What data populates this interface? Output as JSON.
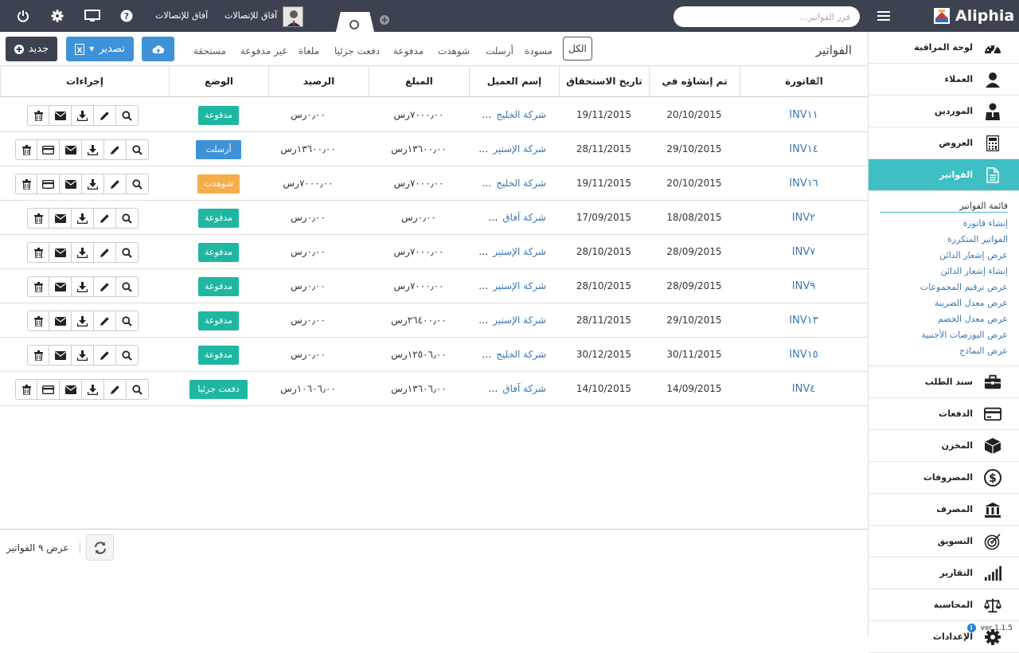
{
  "topbar": {
    "search_placeholder": "فرز الفواتير...",
    "company_name": "آفاق للإتصالات",
    "company_name2": "آفاق للإتصالات",
    "brand": "Aliphia"
  },
  "sidebar": {
    "items": [
      {
        "label": "لوحة المراقبة",
        "icon": "dashboard-icon"
      },
      {
        "label": "العملاء",
        "icon": "user-icon"
      },
      {
        "label": "الموردين",
        "icon": "supplier-icon"
      },
      {
        "label": "العروض",
        "icon": "calculator-icon"
      },
      {
        "label": "الفواتير",
        "icon": "document-icon"
      },
      {
        "label": "سند الطلب",
        "icon": "briefcase-icon"
      },
      {
        "label": "الدفعات",
        "icon": "credit-card-icon"
      },
      {
        "label": "المخزن",
        "icon": "cube-icon"
      },
      {
        "label": "المصروفات",
        "icon": "dollar-icon"
      },
      {
        "label": "المصرف",
        "icon": "bank-icon"
      },
      {
        "label": "التسويق",
        "icon": "target-icon"
      },
      {
        "label": "التقارير",
        "icon": "bar-chart-icon"
      },
      {
        "label": "المحاسبة",
        "icon": "balance-scale-icon"
      },
      {
        "label": "الإعدادات",
        "icon": "gear-icon"
      }
    ],
    "submenu": {
      "heading": "قائمة الفواتير",
      "links": [
        "إنشاء فاتورة",
        "الفواتير المتكررة",
        "عرض إشعار الدائن",
        "إنشاء إشعار الدائن",
        "عرض ترقيم المجموعات",
        "عرض معدل الضريبة",
        "عرض معدل الخصم",
        "عرض البورصات الأجنبية",
        "عرض النماذج"
      ]
    },
    "version": "ver 1.1.5"
  },
  "toolbar": {
    "new_label": "جديد",
    "export_label": "تصدير",
    "page_title": "الفواتير",
    "filters": [
      "الكل",
      "مسودة",
      "أرسلت",
      "شوهدت",
      "مدفوعة",
      "دفعت جزئيا",
      "ملغاة",
      "غير مدفوعة",
      "مستحقة"
    ]
  },
  "table": {
    "headers": {
      "invoice": "الفاتورة",
      "created": "تم إنشاؤه في",
      "due": "تاريخ الاستحقاق",
      "client": "إسم العميل",
      "amount": "المبلغ",
      "balance": "الرصيد",
      "status": "الوضع",
      "actions": "إجراءات"
    },
    "rows": [
      {
        "invoice": "INV١١",
        "created": "20/10/2015",
        "due": "19/11/2015",
        "client": "شركة الخليج",
        "amount": "٧٠٠٠٫٠٠رس",
        "balance": "٠٫٠٠رس",
        "status": "مدفوعة",
        "status_type": "paid",
        "extended": false
      },
      {
        "invoice": "INV١٤",
        "created": "29/10/2015",
        "due": "28/11/2015",
        "client": "شركة الإستير",
        "amount": "١٣٦٠٠٫٠٠رس",
        "balance": "١٣٦٠٠٫٠٠رس",
        "status": "أرسلت",
        "status_type": "sent",
        "extended": true
      },
      {
        "invoice": "INV١٦",
        "created": "20/10/2015",
        "due": "19/11/2015",
        "client": "شركة الخليج",
        "amount": "٧٠٠٠٫٠٠رس",
        "balance": "٧٠٠٠٫٠٠رس",
        "status": "شوهدت",
        "status_type": "seen",
        "extended": true
      },
      {
        "invoice": "INV٢",
        "created": "18/08/2015",
        "due": "17/09/2015",
        "client": "شركة آفاق",
        "amount": "٠٫٠٠رس",
        "balance": "٠٫٠٠رس",
        "status": "مدفوعة",
        "status_type": "paid",
        "extended": false
      },
      {
        "invoice": "INV٧",
        "created": "28/09/2015",
        "due": "28/10/2015",
        "client": "شركة الإستير",
        "amount": "٧٠٠٠٫٠٠رس",
        "balance": "٠٫٠٠رس",
        "status": "مدفوعة",
        "status_type": "paid",
        "extended": false
      },
      {
        "invoice": "INV٩",
        "created": "28/09/2015",
        "due": "28/10/2015",
        "client": "شركة الإستير",
        "amount": "٧٠٠٠٫٠٠رس",
        "balance": "٠٫٠٠رس",
        "status": "مدفوعة",
        "status_type": "paid",
        "extended": false
      },
      {
        "invoice": "INV١٣",
        "created": "29/10/2015",
        "due": "28/11/2015",
        "client": "شركة الإستير",
        "amount": "٢٦٤٠٠٫٠٠رس",
        "balance": "٠٫٠٠رس",
        "status": "مدفوعة",
        "status_type": "paid",
        "extended": false
      },
      {
        "invoice": "INV١٥",
        "created": "30/11/2015",
        "due": "30/12/2015",
        "client": "شركة الخليج",
        "amount": "١٢٥٠٦٫٠٠رس",
        "balance": "٠٫٠٠رس",
        "status": "مدفوعة",
        "status_type": "paid",
        "extended": false
      },
      {
        "invoice": "INV٤",
        "created": "14/09/2015",
        "due": "14/10/2015",
        "client": "شركة آفاق",
        "amount": "١٣٦٠٦٫٠٠رس",
        "balance": "١٠٦٠٦٫٠٠رس",
        "status": "دفعت جزئيا",
        "status_type": "part",
        "extended": true
      }
    ]
  },
  "footer": {
    "count_text": "عرض ٩ الفواتير"
  }
}
